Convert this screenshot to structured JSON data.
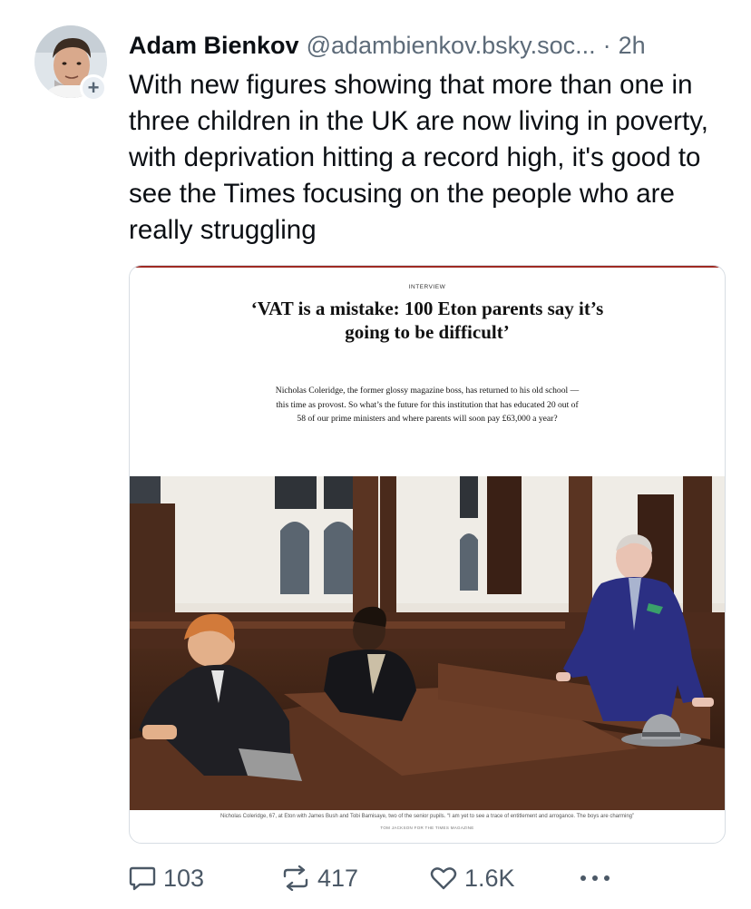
{
  "post": {
    "author": {
      "display_name": "Adam Bienkov",
      "handle": "@adambienkov.bsky.soc...",
      "avatar_icon": "profile-photo",
      "follow_icon": "plus-icon"
    },
    "separator": "·",
    "time": "2h",
    "text": "With new figures showing that more than one in three children in the UK are now living in poverty, with deprivation hitting a record high, it's good to see the Times focusing on the people who are really struggling"
  },
  "embed": {
    "kicker": "INTERVIEW",
    "headline": "‘VAT is a mistake: 100 Eton parents say it’s going to be difficult’",
    "standfirst": "Nicholas Coleridge, the former glossy magazine boss, has returned to his old school — this time as provost. So what’s the future for this institution that has educated 20 out of 58 of our prime ministers and where parents will soon pay £63,000 a year?",
    "caption": "Nicholas Coleridge, 67, at Eton with James Bush and Tobi Bamisaye, two of the senior pupils. “I am yet to see a trace of entitlement and arrogance. The boys are charming”",
    "credit": "TOM JACKSON FOR THE TIMES MAGAZINE",
    "accent_color": "#9e2a23"
  },
  "actions": {
    "replies": "103",
    "reposts": "417",
    "likes": "1.6K",
    "more_icon": "ellipsis-icon",
    "icon_color": "#4b5866"
  }
}
